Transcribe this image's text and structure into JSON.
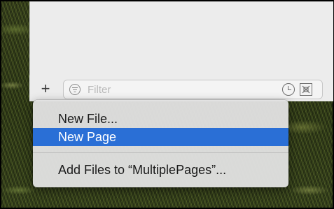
{
  "navigator": {
    "add_button_symbol": "+",
    "filter": {
      "placeholder": "Filter",
      "icons": [
        "filter-icon",
        "clock-icon",
        "scope-icon"
      ]
    }
  },
  "context_menu": {
    "items": [
      {
        "label": "New File...",
        "selected": false
      },
      {
        "label": "New Page",
        "selected": true
      },
      {
        "label": "Add Files to “MultiplePages”...",
        "selected": false
      }
    ]
  },
  "colors": {
    "selection": "#2a6fd6",
    "menu_background": "#e1e1e1",
    "panel_background": "#ececec"
  }
}
